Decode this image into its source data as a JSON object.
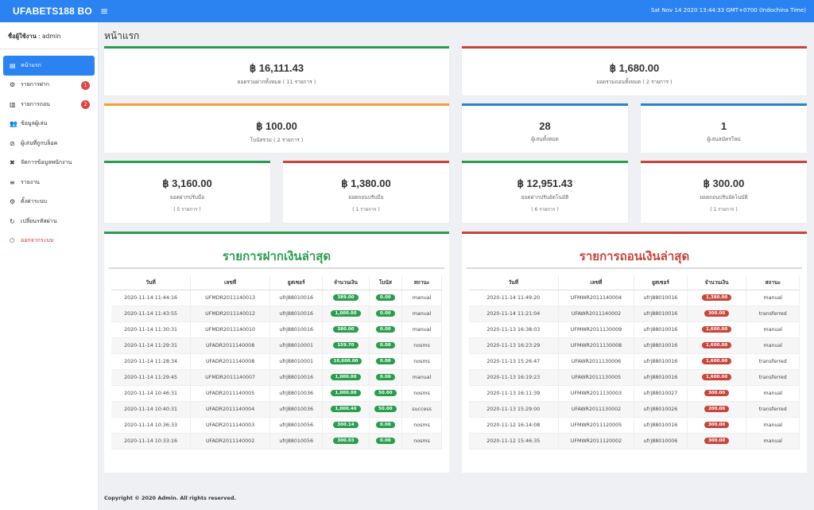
{
  "header": {
    "brand": "UFABETS188 BO",
    "menu_icon": "hamburger-icon",
    "datetime": "Sat Nov 14 2020 13:44:33 GMT+0700 (Indochina Time)"
  },
  "sidebar": {
    "user_label": "ชื่อผู้ใช้งาน",
    "user_name": ": admin",
    "items": [
      {
        "label": "หน้าแรก",
        "icon": "dashboard-icon",
        "glyph": "▤",
        "active": true
      },
      {
        "label": "รายการฝาก",
        "icon": "deposit-icon",
        "glyph": "⚙",
        "badge": "1"
      },
      {
        "label": "รายการถอน",
        "icon": "bank-icon",
        "glyph": "▥",
        "badge": "2"
      },
      {
        "label": "ข้อมูลผู้เล่น",
        "icon": "users-icon",
        "glyph": "👥"
      },
      {
        "label": "ผู้เล่นที่ถูกบล็อค",
        "icon": "blocked-user-icon",
        "glyph": "⊘"
      },
      {
        "label": "จัดการข้อมูลพนักงาน",
        "icon": "staff-icon",
        "glyph": "✖"
      },
      {
        "label": "รายงาน",
        "icon": "report-icon",
        "glyph": "≡"
      },
      {
        "label": "ตั้งค่าระบบ",
        "icon": "gear-icon",
        "glyph": "⚙"
      },
      {
        "label": "เปลี่ยนรหัสผ่าน",
        "icon": "refresh-icon",
        "glyph": "↻"
      },
      {
        "label": "ออกจากระบบ",
        "icon": "power-icon",
        "glyph": "⏻",
        "logout": true
      }
    ]
  },
  "page": {
    "title": "หน้าแรก",
    "footer": "Copyright © 2020 Admin. All rights reserved."
  },
  "cards": {
    "total_deposit": {
      "value": "฿ 16,111.43",
      "label": "ยอดรวมฝากทั้งหมด ( 11 รายการ )"
    },
    "total_withdraw": {
      "value": "฿ 1,680.00",
      "label": "ยอดรวมถอนทั้งหมด ( 2 รายการ )"
    },
    "bonus": {
      "value": "฿ 100.00",
      "label": "โบนัสรวม ( 2 รายการ )"
    },
    "players": {
      "value": "28",
      "label": "ผู้เล่นทั้งหมด"
    },
    "new_players": {
      "value": "1",
      "label": "ผู้เล่นสมัครใหม่"
    },
    "manual_deposit": {
      "value": "฿ 3,160.00",
      "label": "ยอดฝากปรับมือ",
      "sub": "( 5 รายการ )"
    },
    "manual_withdraw": {
      "value": "฿ 1,380.00",
      "label": "ยอดถอนปรับมือ",
      "sub": "( 1 รายการ )"
    },
    "auto_deposit": {
      "value": "฿ 12,951.43",
      "label": "ยอดฝากปรับอัตโนมัติ",
      "sub": "( 6 รายการ )"
    },
    "auto_withdraw": {
      "value": "฿ 300.00",
      "label": "ยอดถอนปรับอัตโนมัติ",
      "sub": "( 1 รายการ )"
    }
  },
  "deposits": {
    "title": "รายการฝากเงินล่าสุด",
    "columns": [
      "วันที่",
      "เลขที่",
      "ยูสเซอร์",
      "จำนวนเงิน",
      "โบนัส",
      "สถานะ"
    ],
    "rows": [
      [
        "2020-11-14 11:44:16",
        "UFMDR2011140013",
        "ufrj88010016",
        "389.00",
        "0.00",
        "manual"
      ],
      [
        "2020-11-14 11:43:55",
        "UFMDR2011140012",
        "ufrj88010016",
        "1,000.00",
        "0.00",
        "manual"
      ],
      [
        "2020-11-14 11:30:31",
        "UFMDR2011140010",
        "ufrj88010016",
        "380.00",
        "0.00",
        "manual"
      ],
      [
        "2020-11-14 11:29:31",
        "UFADR2011140008",
        "ufrj88010001",
        "159.70",
        "0.00",
        "nosms"
      ],
      [
        "2020-11-14 11:28:34",
        "UFADR2011140008",
        "ufrj88010001",
        "10,600.00",
        "0.00",
        "nosms"
      ],
      [
        "2020-11-14 11:29:45",
        "UFMDR2011140007",
        "ufrj88010016",
        "1,000.00",
        "0.00",
        "manual"
      ],
      [
        "2020-11-14 10:46:31",
        "UFADR2011140005",
        "ufrj88010036",
        "1,000.00",
        "50.00",
        "nosms"
      ],
      [
        "2020-11-14 10:40:31",
        "UFADR2011140004",
        "ufrj88010036",
        "1,000.40",
        "50.00",
        "success"
      ],
      [
        "2020-11-14 10:36:33",
        "UFADR2011140003",
        "ufrj88010056",
        "300.14",
        "0.00",
        "nosms"
      ],
      [
        "2020-11-14 10:33:16",
        "UFADR2011140002",
        "ufrj88010056",
        "300.03",
        "0.00",
        "nosms"
      ]
    ]
  },
  "withdrawals": {
    "title": "รายการถอนเงินล่าสุด",
    "columns": [
      "วันที่",
      "เลขที่",
      "ยูสเซอร์",
      "จำนวนเงิน",
      "สถานะ"
    ],
    "rows": [
      [
        "2020-11-14 11:49:20",
        "UFMWR2011140004",
        "ufrj88010016",
        "1,380.00",
        "manual"
      ],
      [
        "2020-11-14 11:21:04",
        "UFAWR2011140002",
        "ufrj88010016",
        "300.00",
        "transferred"
      ],
      [
        "2020-11-13 16:38:03",
        "UFMWR2011130009",
        "ufrj88010016",
        "1,600.00",
        "manual"
      ],
      [
        "2020-11-13 16:23:29",
        "UFMWR2011130008",
        "ufrj88010016",
        "1,600.00",
        "manual"
      ],
      [
        "2020-11-13 15:26:47",
        "UFAWR2011130006",
        "ufrj88010016",
        "1,600.00",
        "transferred"
      ],
      [
        "2020-11-13 16:19:23",
        "UFAWR2011130005",
        "ufrj88010016",
        "1,600.00",
        "transferred"
      ],
      [
        "2020-11-13 16:11:39",
        "UFMWR2011130003",
        "ufrj88010027",
        "300.00",
        "manual"
      ],
      [
        "2020-11-13 15:29:00",
        "UFAWR2011130002",
        "ufrj88010026",
        "200.00",
        "transferred"
      ],
      [
        "2020-11-12 16:14:08",
        "UFMWR2011120005",
        "ufrj88010016",
        "300.00",
        "manual"
      ],
      [
        "2020-11-12 15:46:35",
        "UFMWR2011120002",
        "ufrj88010006",
        "300.00",
        "manual"
      ]
    ]
  }
}
